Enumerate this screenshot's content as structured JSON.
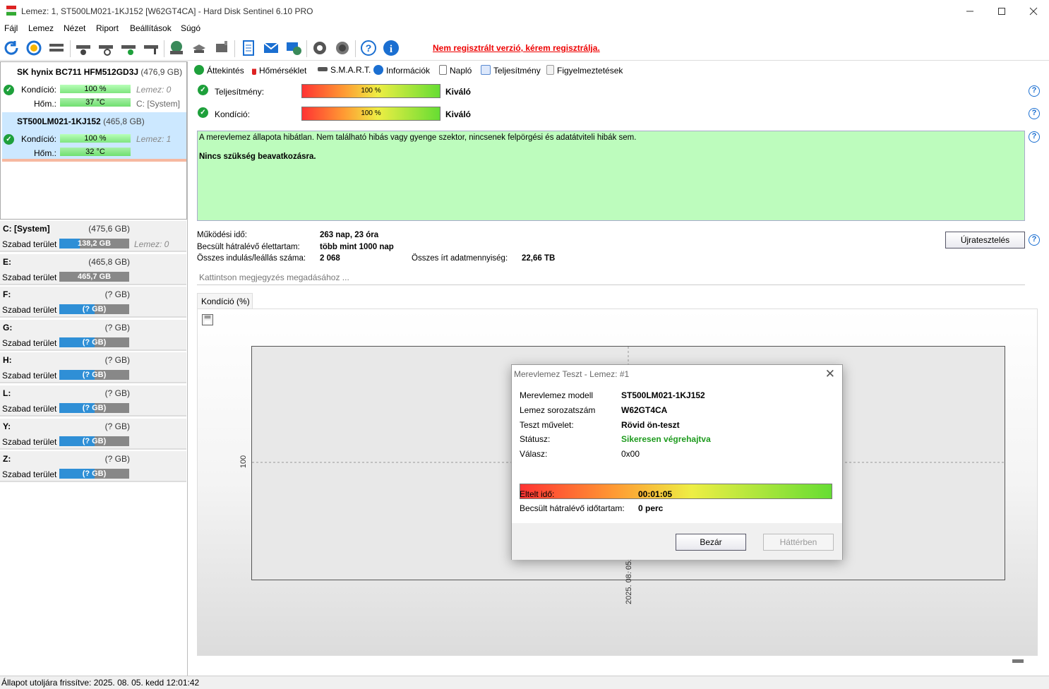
{
  "window": {
    "title": "Lemez: 1, ST500LM021-1KJ152 [W62GT4CA]  -  Hard Disk Sentinel 6.10 PRO"
  },
  "menu": [
    "Fájl",
    "Lemez",
    "Nézet",
    "Riport",
    "Beállítások",
    "Súgó"
  ],
  "toolbar": {
    "register_link": "Nem regisztrált verzió, kérem regisztrálja."
  },
  "disks": [
    {
      "name": "SK hynix BC711 HFM512GD3J",
      "size": "(476,9 GB)",
      "health_label": "Kondíció:",
      "health_value": "100 %",
      "temp_label": "Hőm.:",
      "temp_value": "37 °C",
      "disk_no": "Lemez: 0",
      "partition": "C: [System]"
    },
    {
      "name": "ST500LM021-1KJ152",
      "size": "(465,8 GB)",
      "health_label": "Kondíció:",
      "health_value": "100 %",
      "temp_label": "Hőm.:",
      "temp_value": "32 °C",
      "disk_no": "Lemez: 1"
    }
  ],
  "volumes": [
    {
      "name": "C: [System]",
      "size": "(475,6 GB)",
      "free_label": "Szabad terület",
      "free": "138,2 GB",
      "fill": 0.29,
      "extra": "Lemez: 0"
    },
    {
      "name": "E:",
      "size": "(465,8 GB)",
      "free_label": "Szabad terület",
      "free": "465,7 GB",
      "fill": 0.0,
      "extra": ""
    },
    {
      "name": "F:",
      "size": "(? GB)",
      "free_label": "Szabad terület",
      "free": "(? GB)",
      "fill": 0.5,
      "extra": ""
    },
    {
      "name": "G:",
      "size": "(? GB)",
      "free_label": "Szabad terület",
      "free": "(? GB)",
      "fill": 0.5,
      "extra": ""
    },
    {
      "name": "H:",
      "size": "(? GB)",
      "free_label": "Szabad terület",
      "free": "(? GB)",
      "fill": 0.5,
      "extra": ""
    },
    {
      "name": "L:",
      "size": "(? GB)",
      "free_label": "Szabad terület",
      "free": "(? GB)",
      "fill": 0.5,
      "extra": ""
    },
    {
      "name": "Y:",
      "size": "(? GB)",
      "free_label": "Szabad terület",
      "free": "(? GB)",
      "fill": 0.5,
      "extra": ""
    },
    {
      "name": "Z:",
      "size": "(? GB)",
      "free_label": "Szabad terület",
      "free": "(? GB)",
      "fill": 0.5,
      "extra": ""
    }
  ],
  "tabs": [
    "Áttekintés",
    "Hőmérséklet",
    "S.M.A.R.T.",
    "Információk",
    "Napló",
    "Teljesítmény",
    "Figyelmeztetések"
  ],
  "overview": {
    "perf_label": "Teljesítmény:",
    "perf_value": "100 %",
    "perf_word": "Kiváló",
    "cond_label": "Kondíció:",
    "cond_value": "100 %",
    "cond_word": "Kiváló",
    "status_text": "A merevlemez állapota hibátlan. Nem található hibás vagy gyenge szektor, nincsenek felpörgési és adatátviteli hibák sem.",
    "status_action": "Nincs szükség beavatkozásra.",
    "uptime_label": "Működési idő:",
    "uptime": "263 nap, 23 óra",
    "lifetime_label": "Becsült hátralévő élettartam:",
    "lifetime": "több mint 1000 nap",
    "starts_label": "Összes indulás/leállás száma:",
    "starts": "2 068",
    "written_label": "Összes írt adatmennyiség:",
    "written": "22,66 TB",
    "retest": "Újratesztelés",
    "note_placeholder": "Kattintson megjegyzés megadásához ..."
  },
  "chart": {
    "tab": "Kondíció  (%)",
    "ytick": "100",
    "xtick": "2025. 08. 05."
  },
  "dialog": {
    "title": "Merevlemez Teszt - Lemez: #1",
    "model_label": "Merevlemez modell",
    "model": "ST500LM021-1KJ152",
    "serial_label": "Lemez sorozatszám",
    "serial": "W62GT4CA",
    "op_label": "Teszt művelet:",
    "op": "Rövid ön-teszt",
    "status_label": "Státusz:",
    "status": "Sikeresen végrehajtva",
    "resp_label": "Válasz:",
    "resp": "0x00",
    "progress": 1.0,
    "elapsed_label": "Eltelt idő:",
    "elapsed": "00:01:05",
    "remain_label": "Becsült hátralévő időtartam:",
    "remain": "0 perc",
    "close_btn": "Bezár",
    "bg_btn": "Háttérben",
    "status_color": "#1e9b1e"
  },
  "statusbar": "Állapot utoljára frissítve: 2025. 08. 05. kedd 12:01:42"
}
